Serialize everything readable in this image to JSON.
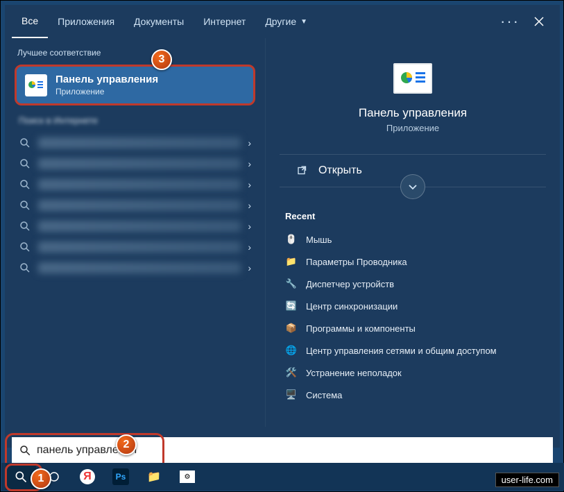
{
  "topbar": {
    "tabs": [
      "Все",
      "Приложения",
      "Документы",
      "Интернет",
      "Другие"
    ],
    "more": "···"
  },
  "left": {
    "best_match_header": "Лучшее соответствие",
    "best": {
      "title": "Панель управления",
      "subtitle": "Приложение"
    },
    "internet_header": "Поиск в Интернете"
  },
  "right": {
    "hero": {
      "title": "Панель управления",
      "subtitle": "Приложение"
    },
    "open": "Открыть",
    "recent_header": "Recent",
    "recent": [
      "Мышь",
      "Параметры Проводника",
      "Диспетчер устройств",
      "Центр синхронизации",
      "Программы и компоненты",
      "Центр управления сетями и общим доступом",
      "Устранение неполадок",
      "Система"
    ]
  },
  "search": {
    "value": "панель управления",
    "placeholder": ""
  },
  "badges": {
    "b1": "1",
    "b2": "2",
    "b3": "3"
  },
  "watermark": "user-life.com"
}
